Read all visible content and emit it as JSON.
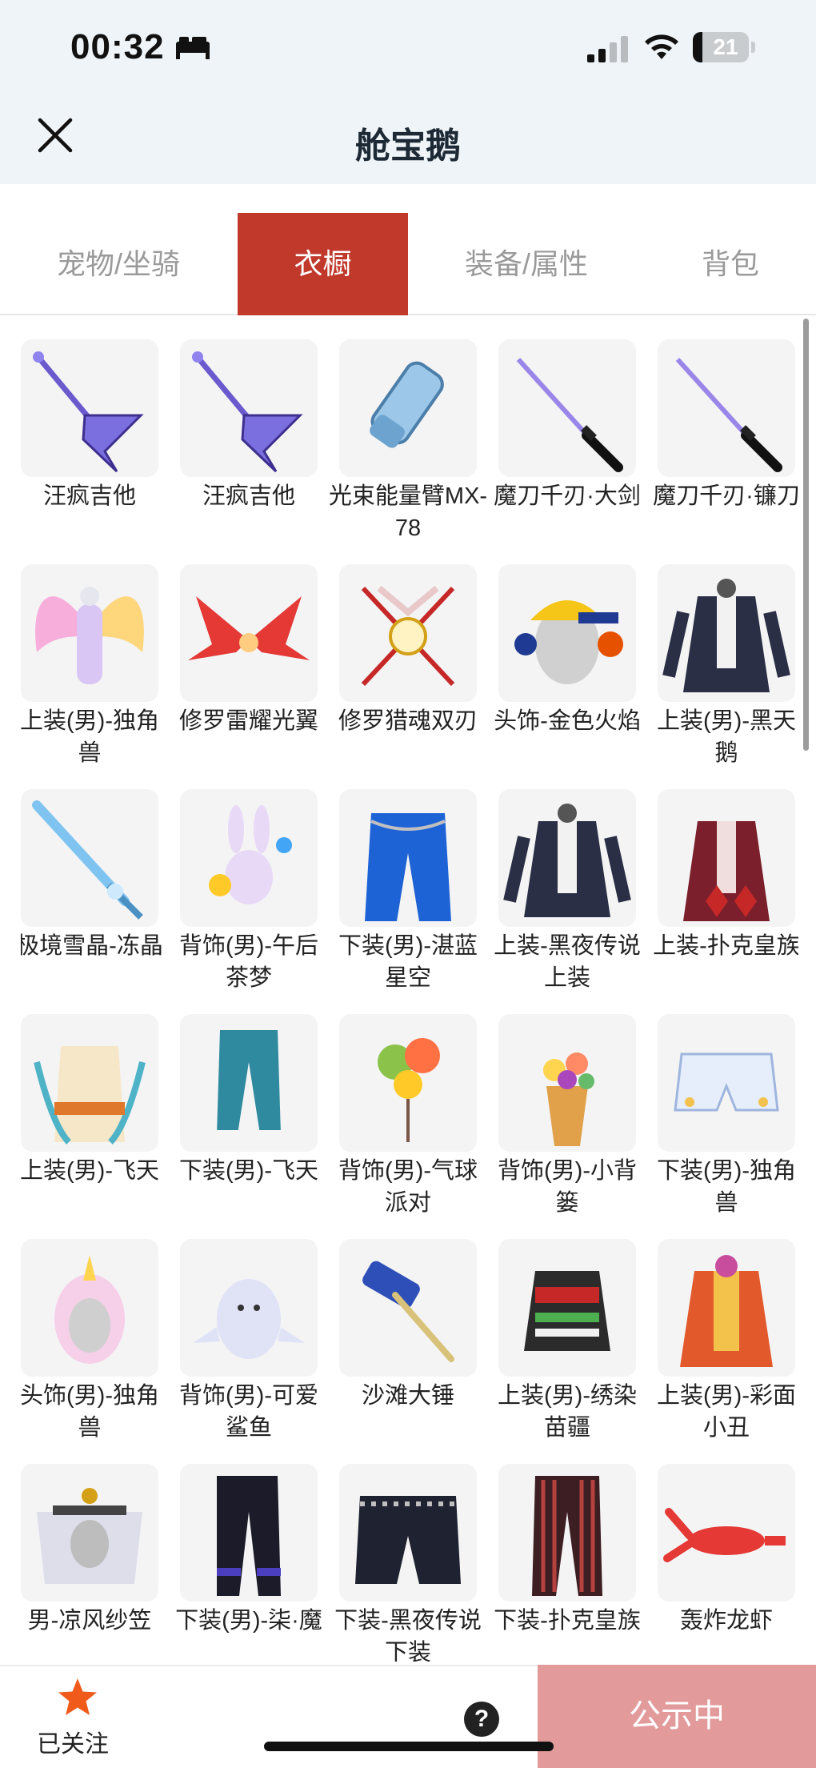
{
  "status_bar": {
    "time": "00:32",
    "battery": "21"
  },
  "header": {
    "title": "舱宝鹅"
  },
  "tabs": [
    {
      "label": "宠物/坐骑",
      "active": false
    },
    {
      "label": "衣橱",
      "active": true
    },
    {
      "label": "装备/属性",
      "active": false
    },
    {
      "label": "背包",
      "active": false
    }
  ],
  "items": [
    {
      "name": "汪疯吉他",
      "icon": "purple-guitar"
    },
    {
      "name": "汪疯吉他",
      "icon": "purple-guitar"
    },
    {
      "name": "光束能量臂MX-78",
      "icon": "energy-arm"
    },
    {
      "name": "魔刀千刃·大剑",
      "icon": "dark-blade"
    },
    {
      "name": "魔刀千刃·镰刀",
      "icon": "dark-blade"
    },
    {
      "name": "上装(男)-独角兽",
      "icon": "rainbow-wing-outfit"
    },
    {
      "name": "修罗雷耀光翼",
      "icon": "red-wings"
    },
    {
      "name": "修罗猎魂双刃",
      "icon": "twin-blades"
    },
    {
      "name": "头饰-金色火焰",
      "icon": "cap-headphones"
    },
    {
      "name": "上装(男)-黑天鹅",
      "icon": "dark-coat"
    },
    {
      "name": "极境雪晶-冻晶",
      "icon": "ice-sword"
    },
    {
      "name": "背饰(男)-午后茶梦",
      "icon": "bunny-pet"
    },
    {
      "name": "下装(男)-湛蓝星空",
      "icon": "blue-jeans"
    },
    {
      "name": "上装-黑夜传说上装",
      "icon": "dark-coat"
    },
    {
      "name": "上装-扑克皇族",
      "icon": "red-coat"
    },
    {
      "name": "上装(男)-飞天",
      "icon": "flying-outfit"
    },
    {
      "name": "下装(男)-飞天",
      "icon": "teal-pants"
    },
    {
      "name": "背饰(男)-气球派对",
      "icon": "balloons"
    },
    {
      "name": "背饰(男)-小背篓",
      "icon": "flower-basket"
    },
    {
      "name": "下装(男)-独角兽",
      "icon": "white-shorts"
    },
    {
      "name": "头饰(男)-独角兽",
      "icon": "unicorn-hood"
    },
    {
      "name": "背饰(男)-可爱鲨鱼",
      "icon": "shark"
    },
    {
      "name": "沙滩大锤",
      "icon": "hammer"
    },
    {
      "name": "上装(男)-绣染苗疆",
      "icon": "embroidered-top"
    },
    {
      "name": "上装(男)-彩面小丑",
      "icon": "clown-outfit"
    },
    {
      "name": "男-凉风纱笠",
      "icon": "veil-hat"
    },
    {
      "name": "下装(男)-柒·魔",
      "icon": "black-pants"
    },
    {
      "name": "下装-黑夜传说下装",
      "icon": "black-shorts"
    },
    {
      "name": "下装-扑克皇族",
      "icon": "striped-pants"
    },
    {
      "name": "轰炸龙虾",
      "icon": "lobster"
    }
  ],
  "bottom_bar": {
    "follow_label": "已关注",
    "help": "?",
    "status_button": "公示中"
  }
}
